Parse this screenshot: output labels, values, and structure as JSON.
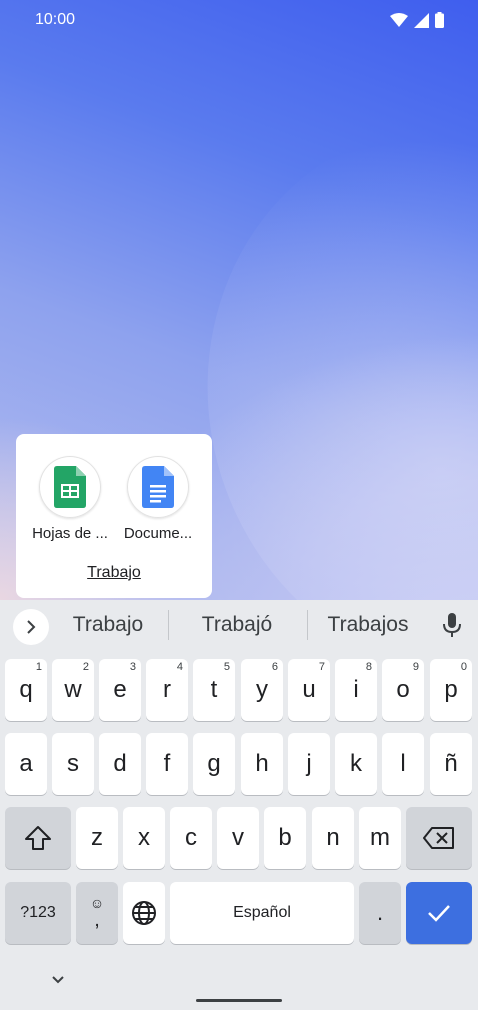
{
  "status_bar": {
    "time": "10:00",
    "icons": [
      "wifi-icon",
      "cellular-signal-icon",
      "battery-icon"
    ]
  },
  "folder": {
    "name": "Trabajo",
    "apps": [
      {
        "label": "Hojas de ...",
        "icon": "google-sheets-icon"
      },
      {
        "label": "Docume...",
        "icon": "google-docs-icon"
      }
    ]
  },
  "keyboard": {
    "suggestions": [
      "Trabajo",
      "Trabajó",
      "Trabajos"
    ],
    "row1": [
      {
        "key": "q",
        "hint": "1"
      },
      {
        "key": "w",
        "hint": "2"
      },
      {
        "key": "e",
        "hint": "3"
      },
      {
        "key": "r",
        "hint": "4"
      },
      {
        "key": "t",
        "hint": "5"
      },
      {
        "key": "y",
        "hint": "6"
      },
      {
        "key": "u",
        "hint": "7"
      },
      {
        "key": "i",
        "hint": "8"
      },
      {
        "key": "o",
        "hint": "9"
      },
      {
        "key": "p",
        "hint": "0"
      }
    ],
    "row2": [
      "a",
      "s",
      "d",
      "f",
      "g",
      "h",
      "j",
      "k",
      "l",
      "ñ"
    ],
    "row3": [
      "z",
      "x",
      "c",
      "v",
      "b",
      "n",
      "m"
    ],
    "symbols_label": "?123",
    "emoji_top": "☺",
    "comma": ",",
    "space_label": "Español",
    "period": "."
  },
  "colors": {
    "enter_key": "#3d6fe0",
    "sheets_green": "#23a566",
    "docs_blue": "#4285f4"
  }
}
